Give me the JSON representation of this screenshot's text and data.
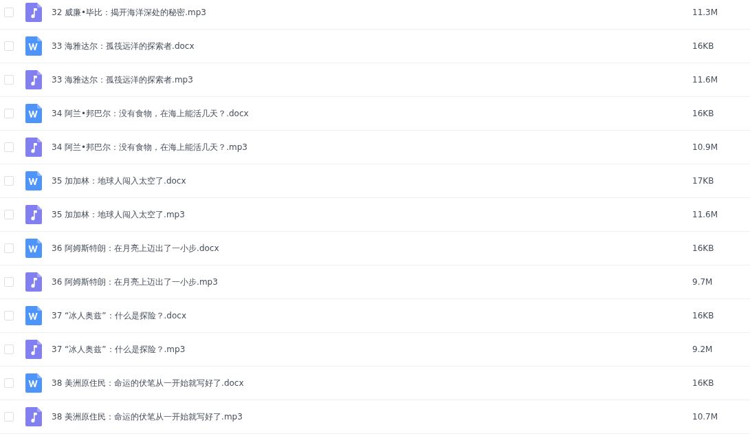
{
  "files": [
    {
      "kind": "audio",
      "checked": false,
      "name": "32 威廉•毕比：揭开海洋深处的秘密.mp3",
      "size": "11.3M"
    },
    {
      "kind": "word",
      "checked": false,
      "name": "33 海雅达尔：孤筏远洋的探索者.docx",
      "size": "16KB"
    },
    {
      "kind": "audio",
      "checked": false,
      "name": "33 海雅达尔：孤筏远洋的探索者.mp3",
      "size": "11.6M"
    },
    {
      "kind": "word",
      "checked": false,
      "name": "34 阿兰•邦巴尔：没有食物，在海上能活几天？.docx",
      "size": "16KB"
    },
    {
      "kind": "audio",
      "checked": false,
      "name": "34 阿兰•邦巴尔：没有食物，在海上能活几天？.mp3",
      "size": "10.9M"
    },
    {
      "kind": "word",
      "checked": false,
      "name": "35 加加林：地球人闯入太空了.docx",
      "size": "17KB"
    },
    {
      "kind": "audio",
      "checked": false,
      "name": "35 加加林：地球人闯入太空了.mp3",
      "size": "11.6M"
    },
    {
      "kind": "word",
      "checked": false,
      "name": "36 阿姆斯特朗：在月亮上迈出了一小步.docx",
      "size": "16KB"
    },
    {
      "kind": "audio",
      "checked": false,
      "name": "36 阿姆斯特朗：在月亮上迈出了一小步.mp3",
      "size": "9.7M"
    },
    {
      "kind": "word",
      "checked": false,
      "name": "37 “冰人奥兹”：什么是探险？.docx",
      "size": "16KB"
    },
    {
      "kind": "audio",
      "checked": false,
      "name": "37 “冰人奥兹”：什么是探险？.mp3",
      "size": "9.2M"
    },
    {
      "kind": "word",
      "checked": false,
      "name": "38 美洲原住民：命运的伏笔从一开始就写好了.docx",
      "size": "16KB"
    },
    {
      "kind": "audio",
      "checked": false,
      "name": "38 美洲原住民：命运的伏笔从一开始就写好了.mp3",
      "size": "10.7M"
    }
  ]
}
